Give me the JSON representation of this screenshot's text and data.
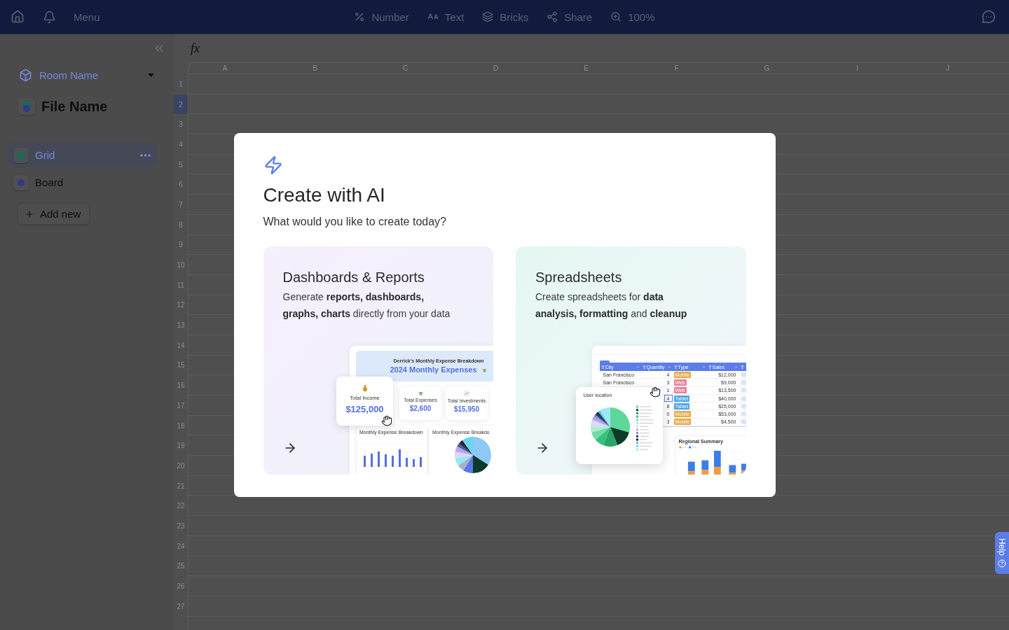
{
  "top_bar": {
    "menu_label": "Menu",
    "tools": [
      {
        "kind": "number",
        "label": "Number"
      },
      {
        "kind": "text",
        "label": "Text"
      },
      {
        "kind": "bricks",
        "label": "Bricks"
      },
      {
        "kind": "share",
        "label": "Share"
      },
      {
        "kind": "zoom",
        "label": "100%"
      }
    ]
  },
  "sidebar": {
    "room_name": "Room Name",
    "file_name": "File Name",
    "items": [
      {
        "label": "Grid",
        "selected": true,
        "color": "#0e6e5a"
      },
      {
        "label": "Board",
        "selected": false,
        "color": "#2e3b87"
      }
    ],
    "add_label": "Add new"
  },
  "formula_bar": {
    "label": "fx"
  },
  "sheet": {
    "columns": [
      "A",
      "B",
      "C",
      "D",
      "E",
      "F",
      "G",
      "I",
      "J"
    ],
    "rows": [
      {
        "label": "1",
        "active": true,
        "selected": false
      },
      {
        "label": "2",
        "active": true,
        "selected": true
      },
      {
        "label": "3",
        "active": false,
        "selected": false
      },
      {
        "label": "4",
        "active": false,
        "selected": false
      },
      {
        "label": "5",
        "active": false,
        "selected": false
      },
      {
        "label": "6",
        "active": false,
        "selected": false
      },
      {
        "label": "7",
        "active": false,
        "selected": false
      },
      {
        "label": "8",
        "active": false,
        "selected": false
      },
      {
        "label": "9",
        "active": false,
        "selected": false
      },
      {
        "label": "10",
        "active": false,
        "selected": false
      },
      {
        "label": "11",
        "active": false,
        "selected": false
      },
      {
        "label": "12",
        "active": false,
        "selected": false
      },
      {
        "label": "13",
        "active": false,
        "selected": false
      },
      {
        "label": "14",
        "active": false,
        "selected": false
      },
      {
        "label": "15",
        "active": false,
        "selected": false
      },
      {
        "label": "16",
        "active": false,
        "selected": false
      },
      {
        "label": "17",
        "active": false,
        "selected": false
      },
      {
        "label": "18",
        "active": false,
        "selected": false
      },
      {
        "label": "19",
        "active": false,
        "selected": false
      },
      {
        "label": "20",
        "active": false,
        "selected": false
      },
      {
        "label": "21",
        "active": false,
        "selected": false
      },
      {
        "label": "22",
        "active": false,
        "selected": false
      },
      {
        "label": "23",
        "active": false,
        "selected": false
      },
      {
        "label": "24",
        "active": false,
        "selected": false
      },
      {
        "label": "25",
        "active": false,
        "selected": false
      },
      {
        "label": "26",
        "active": false,
        "selected": false
      },
      {
        "label": "27",
        "active": false,
        "selected": false
      }
    ]
  },
  "dialog": {
    "title": "Create with AI",
    "subtitle": "What would you like to create today?",
    "cards": [
      {
        "kind": "dashboards",
        "title": "Dashboards & Reports",
        "description": "Generate **reports, dashboards,**\n**graphs, charts** directly from your data",
        "preview": {
          "caption": "Derrick's Monthly Expense Breakdown",
          "heading": "2024 Monthly Expenses",
          "highlight": {
            "label": "Total Income",
            "value": "$125,000"
          },
          "stats": [
            {
              "kind": "expenses",
              "label": "Total Expenses",
              "value": "$2,600"
            },
            {
              "kind": "investments",
              "label": "Total Investments",
              "value": "$15,950"
            }
          ],
          "charts": [
            {
              "kind": "bars",
              "title": "Monthly Expense Breakdown"
            },
            {
              "kind": "pie",
              "title": "Monthly Expense Breakdo"
            }
          ]
        }
      },
      {
        "kind": "spreadsheets",
        "title": "Spreadsheets",
        "description": "Create spreadsheets for **data**\n**analysis, formatting** and **cleanup**",
        "preview": {
          "columns": [
            "City",
            "Quantity",
            "Type",
            "Sales"
          ],
          "rows": [
            {
              "city": "San Francisco",
              "quantity": "4",
              "type": {
                "label": "Mobile",
                "color": "#e8a948"
              },
              "sales": "$12,000",
              "selected": false
            },
            {
              "city": "San Francisco",
              "quantity": "3",
              "type": {
                "label": "Web",
                "color": "#ec7f95"
              },
              "sales": "$9,000",
              "selected": false
            },
            {
              "quantity": "1",
              "type": {
                "label": "Web",
                "color": "#ec7f95"
              },
              "sales": "$13,500",
              "selected": false
            },
            {
              "quantity": "4",
              "type": {
                "label": "Tablet",
                "color": "#4ba4ec"
              },
              "sales": "$40,000",
              "selected": true
            },
            {
              "quantity": "8",
              "type": {
                "label": "Tablet",
                "color": "#4ba4ec"
              },
              "sales": "$25,000",
              "selected": false
            },
            {
              "quantity": "0",
              "type": {
                "label": "Mobile",
                "color": "#e8a948"
              },
              "sales": "$53,000",
              "selected": false
            },
            {
              "quantity": "3",
              "type": {
                "label": "Mobile",
                "color": "#e8a948"
              },
              "sales": "$4,500",
              "selected": false
            }
          ],
          "location_title": "User location",
          "summary_title": "Regional Summary"
        }
      }
    ]
  },
  "help_tab": {
    "label": "Help"
  }
}
